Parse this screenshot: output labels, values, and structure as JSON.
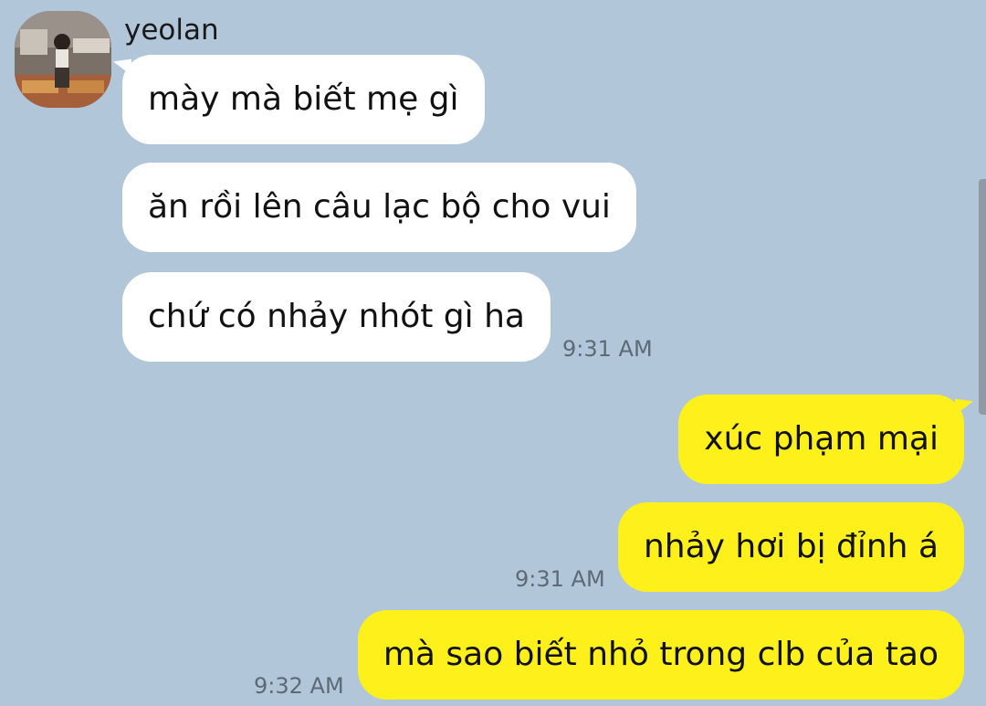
{
  "chat": {
    "sender": "yeolan",
    "avatar_label": "profile photo",
    "messages": [
      {
        "side": "in",
        "text": "mày mà biết mẹ gì"
      },
      {
        "side": "in",
        "text": "ăn rồi lên câu lạc bộ cho vui"
      },
      {
        "side": "in",
        "text": "chứ có nhảy nhót gì ha",
        "time": "9:31 AM"
      },
      {
        "side": "out",
        "text": "xúc phạm mại"
      },
      {
        "side": "out",
        "text": "nhảy hơi bị đỉnh á",
        "time": "9:31 AM"
      },
      {
        "side": "out",
        "text": "mà sao biết nhỏ trong clb của tao",
        "time": "9:32 AM"
      }
    ]
  },
  "colors": {
    "background": "#b2c6da",
    "incoming_bubble": "#ffffff",
    "outgoing_bubble": "#fef01b",
    "timestamp": "#5d6a76"
  }
}
